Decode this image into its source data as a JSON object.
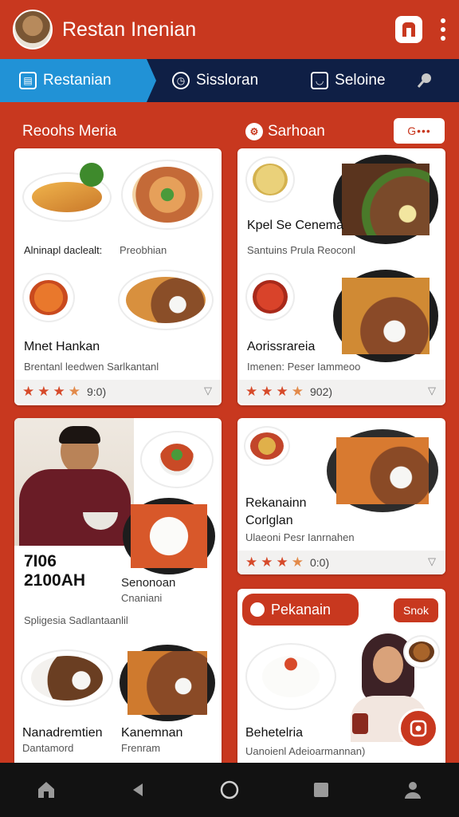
{
  "app": {
    "title": "Restan Inenian",
    "avatar_icon": "monkey-avatar",
    "action_icon": "app-logo-icon",
    "more_icon": "more-vertical-icon"
  },
  "tabs": [
    {
      "label": "Restanian",
      "icon": "grid-icon",
      "active": true
    },
    {
      "label": "Sissloran",
      "icon": "clock-icon",
      "active": false
    },
    {
      "label": "Seloine",
      "icon": "chat-icon",
      "active": false
    },
    {
      "label": "",
      "icon": "pin-icon",
      "active": false
    }
  ],
  "sections": {
    "left_title": "Reoohs Meria",
    "right_title": "Sarhoan",
    "filter_label": "G•••"
  },
  "cards": {
    "card1": {
      "row1_left": "Alninapl daclealt:",
      "row1_right": "Preobhian",
      "title": "Mnet Hankan",
      "desc": "Brentanl leedwen Sarlkantanl",
      "rating_text": "9:0)",
      "stars": 3.5
    },
    "card2": {
      "title": "Kpel Se Cenema",
      "desc": "Santuins Prula Reoconl",
      "subtitle": "Aorissrareia",
      "desc2": "Imenen: Peser Iammeoo",
      "rating_text": "902)",
      "stars": 3.5
    },
    "card3": {
      "price_line1": "7I06",
      "price_line2": "2100AH",
      "dish_title": "Senonoan",
      "dish_sub": "Cnaniani",
      "desc": "Spligesia Sadlantaanlil",
      "item1_title": "Nanadremtien",
      "item1_sub": "Dantamord",
      "item2_title": "Kanemnan",
      "item2_sub": "Frenram"
    },
    "card4": {
      "title1": "Rekanainn",
      "title2": "Corlglan",
      "desc": "Ulaeoni Pesr Ianrnahen",
      "rating_text": "0:0)",
      "stars": 3.5
    },
    "card5": {
      "pill_label": "Pekanain",
      "button_label": "Snok",
      "title": "Behetelria",
      "desc": "Uanoienl Adeioarmannan)"
    }
  },
  "bottom_nav": [
    "home-icon",
    "back-icon",
    "circle-home-icon",
    "recents-icon",
    "profile-icon"
  ],
  "colors": {
    "brand_red": "#c8381f",
    "tab_navy": "#0f1f45",
    "tab_active": "#2192d6",
    "star": "#d64a2a"
  }
}
